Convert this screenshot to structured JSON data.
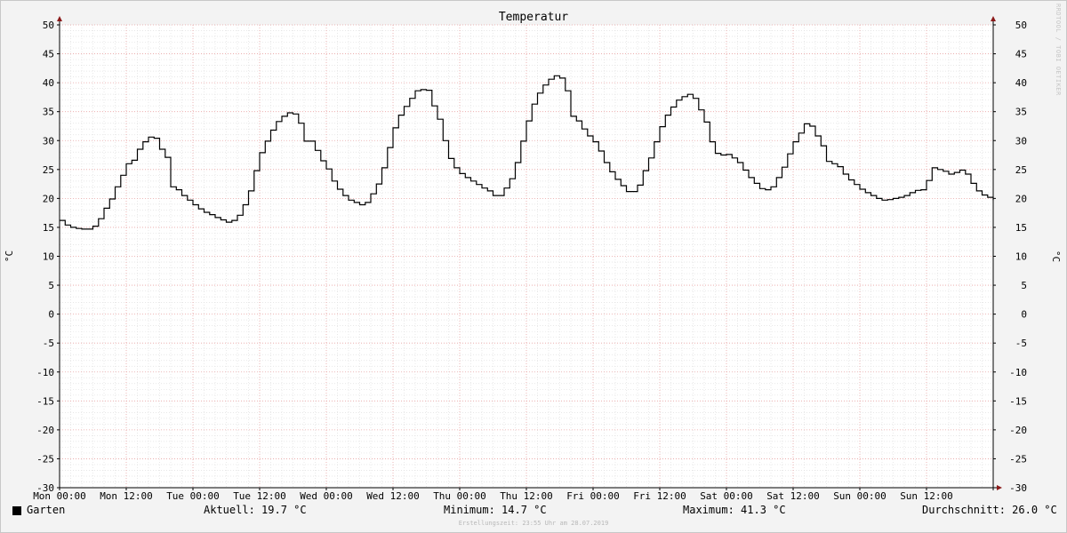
{
  "chart_data": {
    "type": "line",
    "title": "Temperatur",
    "ylabel": "°C",
    "ylim": [
      -30,
      50
    ],
    "y_ticks": [
      50,
      45,
      40,
      35,
      30,
      25,
      20,
      15,
      10,
      5,
      0,
      -5,
      -10,
      -15,
      -20,
      -25,
      -30
    ],
    "x_range_hours": [
      0,
      168
    ],
    "x_ticks": [
      {
        "label": "Mon 00:00",
        "hour": 0
      },
      {
        "label": "Mon 12:00",
        "hour": 12
      },
      {
        "label": "Tue 00:00",
        "hour": 24
      },
      {
        "label": "Tue 12:00",
        "hour": 36
      },
      {
        "label": "Wed 00:00",
        "hour": 48
      },
      {
        "label": "Wed 12:00",
        "hour": 60
      },
      {
        "label": "Thu 00:00",
        "hour": 72
      },
      {
        "label": "Thu 12:00",
        "hour": 84
      },
      {
        "label": "Fri 00:00",
        "hour": 96
      },
      {
        "label": "Fri 12:00",
        "hour": 108
      },
      {
        "label": "Sat 00:00",
        "hour": 120
      },
      {
        "label": "Sat 12:00",
        "hour": 132
      },
      {
        "label": "Sun 00:00",
        "hour": 144
      },
      {
        "label": "Sun 12:00",
        "hour": 156
      }
    ],
    "grid": true,
    "series": [
      {
        "name": "Garten",
        "color": "#000000",
        "points": [
          [
            0,
            16.2
          ],
          [
            1,
            15.4
          ],
          [
            2,
            15
          ],
          [
            3,
            14.8
          ],
          [
            4,
            14.7
          ],
          [
            5,
            14.7
          ],
          [
            6,
            15.2
          ],
          [
            7,
            16.5
          ],
          [
            8,
            18.3
          ],
          [
            9,
            19.9
          ],
          [
            10,
            22
          ],
          [
            11,
            24
          ],
          [
            12,
            26
          ],
          [
            13,
            26.6
          ],
          [
            14,
            28.5
          ],
          [
            15,
            29.8
          ],
          [
            16,
            30.6
          ],
          [
            17,
            30.4
          ],
          [
            18,
            28.5
          ],
          [
            19,
            27.1
          ],
          [
            20,
            22
          ],
          [
            21,
            21.5
          ],
          [
            22,
            20.5
          ],
          [
            23,
            19.7
          ],
          [
            24,
            18.9
          ],
          [
            25,
            18.2
          ],
          [
            26,
            17.6
          ],
          [
            27,
            17.2
          ],
          [
            28,
            16.7
          ],
          [
            29,
            16.3
          ],
          [
            30,
            15.9
          ],
          [
            31,
            16.2
          ],
          [
            32,
            17.1
          ],
          [
            33,
            18.9
          ],
          [
            34,
            21.3
          ],
          [
            35,
            24.8
          ],
          [
            36,
            27.9
          ],
          [
            37,
            29.9
          ],
          [
            38,
            31.8
          ],
          [
            39,
            33.3
          ],
          [
            40,
            34.2
          ],
          [
            41,
            34.8
          ],
          [
            42,
            34.6
          ],
          [
            43,
            33
          ],
          [
            44,
            29.9
          ],
          [
            45,
            29.9
          ],
          [
            46,
            28.3
          ],
          [
            47,
            26.5
          ],
          [
            48,
            25.1
          ],
          [
            49,
            23
          ],
          [
            50,
            21.6
          ],
          [
            51,
            20.5
          ],
          [
            52,
            19.7
          ],
          [
            53,
            19.3
          ],
          [
            54,
            18.9
          ],
          [
            55,
            19.3
          ],
          [
            56,
            20.8
          ],
          [
            57,
            22.5
          ],
          [
            58,
            25.3
          ],
          [
            59,
            28.8
          ],
          [
            60,
            32.2
          ],
          [
            61,
            34.4
          ],
          [
            62,
            35.9
          ],
          [
            63,
            37.3
          ],
          [
            64,
            38.6
          ],
          [
            65,
            38.8
          ],
          [
            66,
            38.7
          ],
          [
            67,
            36
          ],
          [
            68,
            33.7
          ],
          [
            69,
            30
          ],
          [
            70,
            26.9
          ],
          [
            71,
            25.3
          ],
          [
            72,
            24.3
          ],
          [
            73,
            23.6
          ],
          [
            74,
            23
          ],
          [
            75,
            22.4
          ],
          [
            76,
            21.8
          ],
          [
            77,
            21.3
          ],
          [
            78,
            20.5
          ],
          [
            79,
            20.5
          ],
          [
            80,
            21.8
          ],
          [
            81,
            23.4
          ],
          [
            82,
            26.2
          ],
          [
            83,
            29.9
          ],
          [
            84,
            33.4
          ],
          [
            85,
            36.3
          ],
          [
            86,
            38.2
          ],
          [
            87,
            39.6
          ],
          [
            88,
            40.6
          ],
          [
            89,
            41.2
          ],
          [
            90,
            40.8
          ],
          [
            91,
            38.6
          ],
          [
            92,
            34.2
          ],
          [
            93,
            33.4
          ],
          [
            94,
            32
          ],
          [
            95,
            30.8
          ],
          [
            96,
            29.8
          ],
          [
            97,
            28.2
          ],
          [
            98,
            26.2
          ],
          [
            99,
            24.6
          ],
          [
            100,
            23.3
          ],
          [
            101,
            22.2
          ],
          [
            102,
            21.2
          ],
          [
            103,
            21.2
          ],
          [
            104,
            22.3
          ],
          [
            105,
            24.8
          ],
          [
            106,
            27
          ],
          [
            107,
            29.8
          ],
          [
            108,
            32.4
          ],
          [
            109,
            34.4
          ],
          [
            110,
            35.8
          ],
          [
            111,
            37
          ],
          [
            112,
            37.6
          ],
          [
            113,
            38
          ],
          [
            114,
            37.3
          ],
          [
            115,
            35.3
          ],
          [
            116,
            33.2
          ],
          [
            117,
            29.8
          ],
          [
            118,
            27.8
          ],
          [
            119,
            27.5
          ],
          [
            120,
            27.6
          ],
          [
            121,
            27
          ],
          [
            122,
            26.2
          ],
          [
            123,
            24.9
          ],
          [
            124,
            23.6
          ],
          [
            125,
            22.6
          ],
          [
            126,
            21.7
          ],
          [
            127,
            21.5
          ],
          [
            128,
            22
          ],
          [
            129,
            23.6
          ],
          [
            130,
            25.4
          ],
          [
            131,
            27.7
          ],
          [
            132,
            29.8
          ],
          [
            133,
            31.3
          ],
          [
            134,
            32.9
          ],
          [
            135,
            32.5
          ],
          [
            136,
            30.8
          ],
          [
            137,
            29.1
          ],
          [
            138,
            26.4
          ],
          [
            139,
            26
          ],
          [
            140,
            25.5
          ],
          [
            141,
            24.2
          ],
          [
            142,
            23.2
          ],
          [
            143,
            22.4
          ],
          [
            144,
            21.6
          ],
          [
            145,
            21
          ],
          [
            146,
            20.5
          ],
          [
            147,
            20
          ],
          [
            148,
            19.7
          ],
          [
            149,
            19.8
          ],
          [
            150,
            20
          ],
          [
            151,
            20.2
          ],
          [
            152,
            20.5
          ],
          [
            153,
            21
          ],
          [
            154,
            21.4
          ],
          [
            155,
            21.5
          ],
          [
            156,
            23.1
          ],
          [
            157,
            25.3
          ],
          [
            158,
            25
          ],
          [
            159,
            24.7
          ],
          [
            160,
            24.2
          ],
          [
            161,
            24.5
          ],
          [
            162,
            24.9
          ],
          [
            163,
            24.2
          ],
          [
            164,
            22.6
          ],
          [
            165,
            21.3
          ],
          [
            166,
            20.6
          ],
          [
            167,
            20.2
          ],
          [
            168,
            19.7
          ]
        ]
      }
    ]
  },
  "chart_colors": {
    "background": "#f3f3f3",
    "plot_background": "#ffffff",
    "grid_minor": "#e0e0e0",
    "grid_major": "#e8a3a3",
    "axis": "#000000",
    "arrow": "#8b1a1a"
  },
  "watermark": "RRDTOOL / TOBI OETIKER",
  "legend": {
    "series_label": "Garten",
    "current": "Aktuell: 19.7 °C",
    "minimum": "Minimum: 14.7 °C",
    "maximum": "Maximum: 41.3 °C",
    "average": "Durchschnitt: 26.0 °C"
  },
  "footer": "Erstellungszeit: 23:55 Uhr am 28.07.2019"
}
